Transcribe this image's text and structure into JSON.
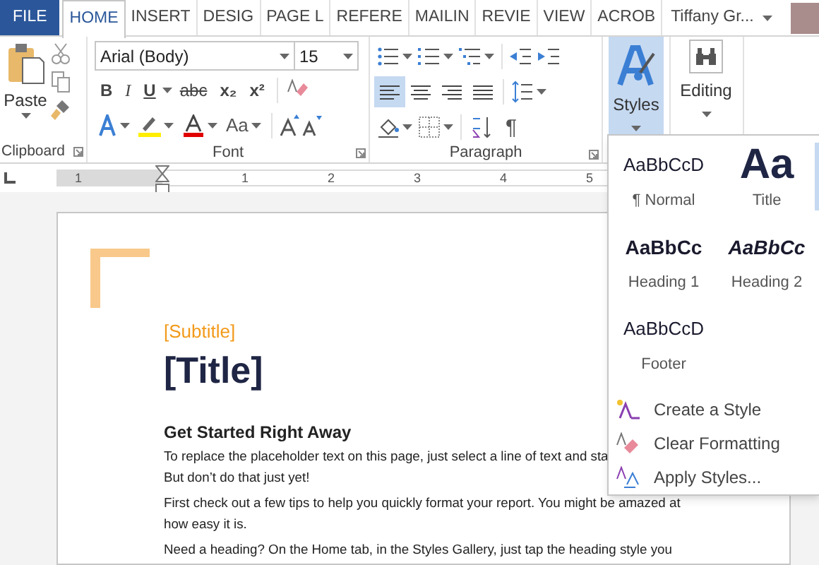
{
  "tabs": [
    {
      "label": "FILE",
      "kind": "file",
      "selected": false
    },
    {
      "label": "HOME",
      "kind": "tab",
      "selected": true
    },
    {
      "label": "INSERT",
      "kind": "tab",
      "selected": false
    },
    {
      "label": "DESIG",
      "kind": "tab",
      "selected": false
    },
    {
      "label": "PAGE L",
      "kind": "tab",
      "selected": false
    },
    {
      "label": "REFERE",
      "kind": "tab",
      "selected": false
    },
    {
      "label": "MAILIN",
      "kind": "tab",
      "selected": false
    },
    {
      "label": "REVIE",
      "kind": "tab",
      "selected": false
    },
    {
      "label": "VIEW",
      "kind": "tab",
      "selected": false
    },
    {
      "label": "ACROB",
      "kind": "tab",
      "selected": false
    }
  ],
  "account": {
    "name": "Tiffany Gr..."
  },
  "clipboard": {
    "paste_label": "Paste",
    "group_label": "Clipboard"
  },
  "font": {
    "family": "Arial (Body)",
    "size": "15",
    "format_buttons": [
      {
        "label": "B",
        "kind": "bold"
      },
      {
        "label": "I",
        "kind": "italic"
      },
      {
        "label": "U",
        "kind": "underline"
      },
      {
        "label": "abc",
        "kind": "strike"
      },
      {
        "label": "x₂",
        "kind": "sub"
      },
      {
        "label": "x²",
        "kind": "sup"
      }
    ],
    "case_button": "Aa",
    "group_label": "Font"
  },
  "paragraph": {
    "align_buttons": [
      {
        "kind": "left",
        "selected": true
      },
      {
        "kind": "center",
        "selected": false
      },
      {
        "kind": "right",
        "selected": false
      },
      {
        "kind": "justify",
        "selected": false
      }
    ],
    "pilcrow": "¶",
    "group_label": "Paragraph"
  },
  "styles_button": {
    "label": "Styles",
    "selected": true
  },
  "editing_button": {
    "label": "Editing"
  },
  "ruler": {
    "labels": [
      "1",
      "1",
      "2",
      "3",
      "4",
      "5"
    ]
  },
  "document": {
    "subtitle": "[Subtitle]",
    "title": "[Title]",
    "heading": "Get Started Right Away",
    "paragraphs": [
      [
        "To replace the placeholder text on this page, just select a line of text and sta",
        "But don’t do that just yet!"
      ],
      [
        "First check out a few tips to help you quickly format your report. You might be amazed at",
        "how easy it is."
      ],
      [
        "Need a heading? On the Home tab, in the Styles Gallery, just tap the heading style you"
      ]
    ]
  },
  "styles_menu": {
    "gallery": [
      {
        "preview": "AaBbCcD",
        "name": "¶ Normal",
        "kind": "normal"
      },
      {
        "preview": "Aa",
        "name": "Title",
        "kind": "title"
      },
      {
        "preview": "AaBbCc",
        "name": "Heading 1",
        "kind": "heading1"
      },
      {
        "preview": "AaBbCc",
        "name": "Heading 2",
        "kind": "heading2"
      },
      {
        "preview": "AaBbCcD",
        "name": "Footer",
        "kind": "normal"
      }
    ],
    "commands": [
      {
        "label": "Create a Style",
        "kind": "create"
      },
      {
        "label": "Clear Formatting",
        "kind": "clear"
      },
      {
        "label": "Apply Styles...",
        "kind": "apply"
      }
    ]
  }
}
